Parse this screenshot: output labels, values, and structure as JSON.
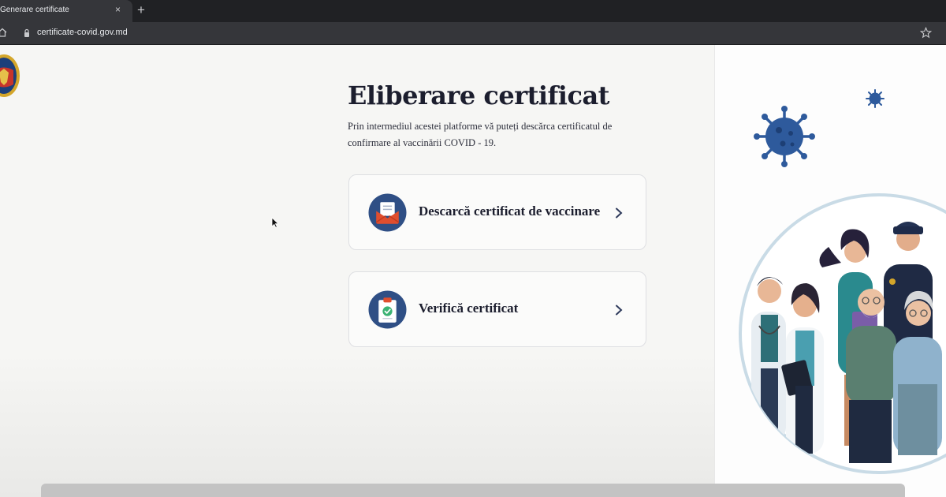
{
  "browser": {
    "tab_title": "Generare certificate",
    "tab_close": "×",
    "new_tab": "+",
    "url": "certificate-covid.gov.md"
  },
  "page": {
    "title": "Eliberare certificat",
    "subtitle": "Prin intermediul acestei platforme vă puteți descărca certificatul de confirmare al vaccinării COVID - 19."
  },
  "cards": [
    {
      "label": "Descarcă certificat de vaccinare",
      "icon": "envelope-certificate-icon"
    },
    {
      "label": "Verifică certificat",
      "icon": "clipboard-check-icon"
    }
  ],
  "colors": {
    "title_text": "#1c1e2e",
    "icon_blue": "#2f4f85",
    "icon_orange": "#e04e2e",
    "check_green": "#3bb273",
    "virus_blue": "#2e5a9c",
    "browser_dark": "#202124"
  }
}
